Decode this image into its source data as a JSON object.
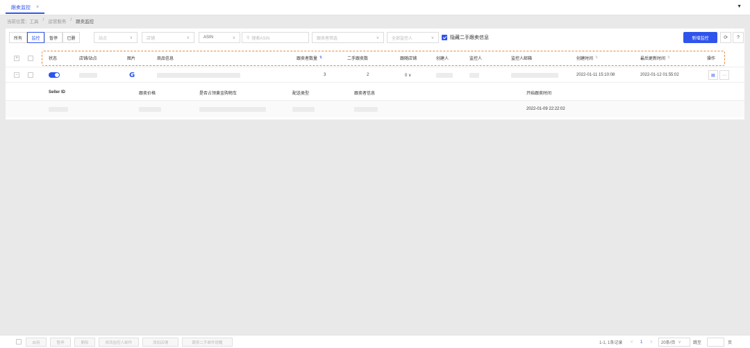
{
  "tabbar": {
    "tab_label": "跟卖监控",
    "close_glyph": "×",
    "dropdown_glyph": "▼"
  },
  "breadcrumb": {
    "prefix": "当前位置：",
    "items": [
      "工具",
      "/",
      "运营服务",
      "/",
      "跟卖监控"
    ]
  },
  "filters": {
    "seg_all": "所有",
    "seg_monitoring": "监控",
    "seg_paused": "暂停",
    "seg_deleted": "已删",
    "select_site": "站点",
    "select_store": "店铺",
    "select_asin": "ASIN",
    "search_placeholder": "搜索ASIN",
    "select_follower": "跟卖者筛选",
    "select_monitor": "全部监控人",
    "hide_checkbox_label": "隐藏二手跟卖信息",
    "new_button": "新增监控",
    "refresh_icon": "refresh-icon",
    "help_glyph": "?"
  },
  "table": {
    "headers": {
      "status": "状态",
      "store_site": "店铺/站点",
      "image": "图片",
      "product_info": "商品信息",
      "follower_count": "跟卖者数量",
      "used_follower": "二手跟卖数",
      "buybox_store": "跟随店铺",
      "creator": "创建人",
      "monitor": "监控人",
      "monitor_email": "监控人邮箱",
      "created_time": "创建时间",
      "updated_time": "最后更新时间",
      "action": "操作"
    },
    "row": {
      "follower_count": "3",
      "used_follower": "2",
      "buybox_store": "0 ∨",
      "created_time": "2022-01-11 15:10:08",
      "updated_time": "2022-01-12 01:55:02",
      "image_glyph": "G"
    },
    "sub": {
      "headers": {
        "seller_id": "Seller ID",
        "price": "跟卖价格",
        "buybox": "是否占领黄金购物车",
        "ship": "配送类型",
        "info": "跟卖者信息",
        "start_time": "开始跟卖时间"
      },
      "row": {
        "start_time": "2022-01-09 22:22:02"
      }
    }
  },
  "footer": {
    "enable": "启用",
    "pause": "暂停",
    "delete": "删除",
    "change_monitor": "修改监控人邮件",
    "follow_store": "添加店铺",
    "follow_email": "跟卖二手邮件提醒",
    "total": "1-1, 1条记录",
    "page_prev": "<",
    "page_num": "1",
    "page_next": ">",
    "page_size": "20条/页",
    "goto_label": "跳至",
    "goto_suffix": "页"
  }
}
